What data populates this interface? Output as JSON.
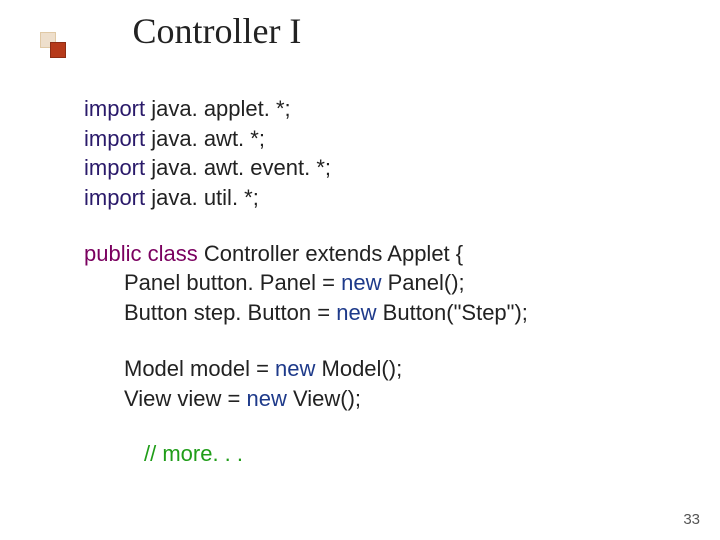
{
  "title": "Controller I",
  "imports": [
    {
      "kw": "import",
      "rest": " java. applet. *;"
    },
    {
      "kw": "import",
      "rest": " java. awt. *;"
    },
    {
      "kw": "import",
      "rest": " java. awt. event. *;"
    },
    {
      "kw": "import",
      "rest": " java. util. *;"
    }
  ],
  "decl": {
    "public": "public",
    "class": "class",
    "name": " Controller ",
    "extends": "extends",
    "applet": " Applet {"
  },
  "fields": [
    {
      "pre": "Panel button. Panel = ",
      "new": "new",
      "post": " Panel();"
    },
    {
      "pre": "Button step. Button = ",
      "new": "new",
      "post": " Button(\"Step\");"
    }
  ],
  "locals": [
    {
      "pre": "Model model = ",
      "new": "new",
      "post": " Model();"
    },
    {
      "pre": "View view = ",
      "new": "new",
      "post": " View();"
    }
  ],
  "comment": "// more. . .",
  "page_number": "33"
}
